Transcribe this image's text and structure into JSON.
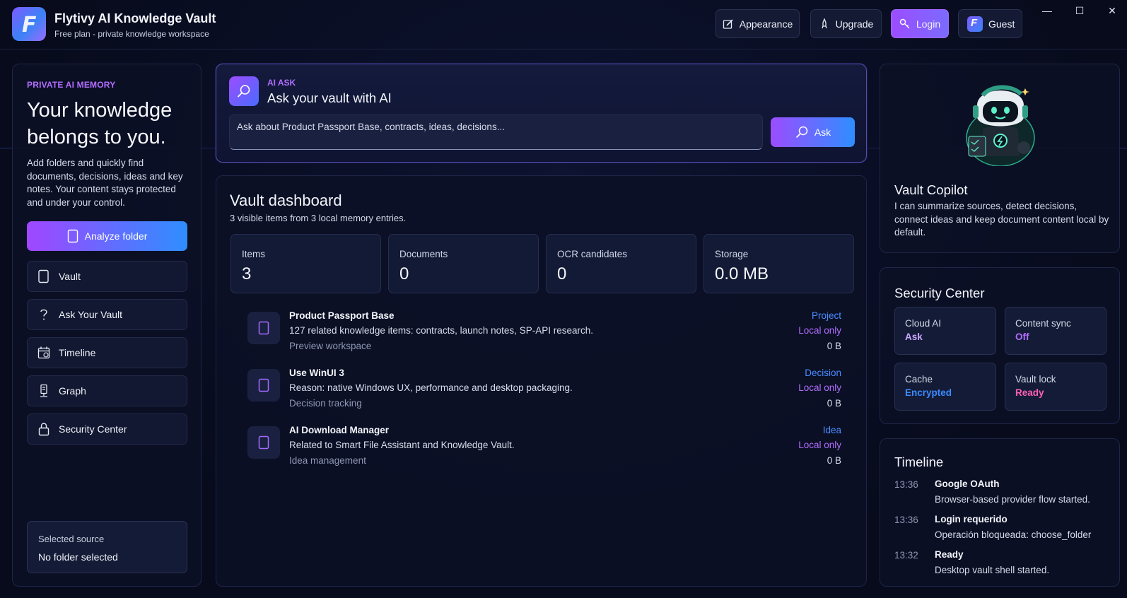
{
  "app": {
    "title": "Flytivy AI Knowledge Vault",
    "subtitle": "Free plan - private knowledge workspace",
    "logo_letter": "F"
  },
  "toolbar": {
    "appearance": "Appearance",
    "upgrade": "Upgrade",
    "login": "Login",
    "guest": "Guest"
  },
  "window_controls": {
    "minimize": "—",
    "maximize": "☐",
    "close": "✕"
  },
  "sidebar": {
    "kicker": "PRIVATE AI MEMORY",
    "hero": "Your knowledge belongs to you.",
    "description": "Add folders and quickly find documents, decisions, ideas and key notes. Your content stays protected and under your control.",
    "analyze_label": "Analyze folder",
    "nav": [
      {
        "label": "Vault",
        "icon": "document-icon"
      },
      {
        "label": "Ask Your Vault",
        "icon": "question-icon"
      },
      {
        "label": "Timeline",
        "icon": "calendar-icon"
      },
      {
        "label": "Graph",
        "icon": "graph-icon"
      },
      {
        "label": "Security Center",
        "icon": "lock-icon"
      }
    ],
    "source": {
      "label": "Selected source",
      "value": "No folder selected"
    }
  },
  "ask": {
    "kicker": "AI ASK",
    "title": "Ask your vault with AI",
    "placeholder": "Ask about Product Passport Base, contracts, ideas, decisions...",
    "button": "Ask"
  },
  "dashboard": {
    "title": "Vault dashboard",
    "subtitle": "3 visible items from 3 local memory entries.",
    "stats": [
      {
        "label": "Items",
        "value": "3"
      },
      {
        "label": "Documents",
        "value": "0"
      },
      {
        "label": "OCR candidates",
        "value": "0"
      },
      {
        "label": "Storage",
        "value": "0.0 MB"
      }
    ],
    "items": [
      {
        "title": "Product Passport Base",
        "description": "127 related knowledge items: contracts, launch notes, SP-API research.",
        "meta": "Preview workspace",
        "type": "Project",
        "privacy": "Local only",
        "size": "0 B"
      },
      {
        "title": "Use WinUI 3",
        "description": "Reason: native Windows UX, performance and desktop packaging.",
        "meta": "Decision tracking",
        "type": "Decision",
        "privacy": "Local only",
        "size": "0 B"
      },
      {
        "title": "AI Download Manager",
        "description": "Related to Smart File Assistant and Knowledge Vault.",
        "meta": "Idea management",
        "type": "Idea",
        "privacy": "Local only",
        "size": "0 B"
      }
    ]
  },
  "copilot": {
    "title": "Vault Copilot",
    "description": "I can summarize sources, detect decisions, connect ideas and keep document content local by default."
  },
  "security": {
    "title": "Security Center",
    "cards": [
      {
        "label": "Cloud AI",
        "value": "Ask",
        "color": "#c9a7ff"
      },
      {
        "label": "Content sync",
        "value": "Off",
        "color": "#b26dff"
      },
      {
        "label": "Cache",
        "value": "Encrypted",
        "color": "#3b8bff"
      },
      {
        "label": "Vault lock",
        "value": "Ready",
        "color": "#ff5fb3"
      }
    ]
  },
  "timeline": {
    "title": "Timeline",
    "events": [
      {
        "time": "13:36",
        "event": "Google OAuth",
        "detail": "Browser-based provider flow started."
      },
      {
        "time": "13:36",
        "event": "Login requerido",
        "detail": "Operación bloqueada: choose_folder"
      },
      {
        "time": "13:32",
        "event": "Ready",
        "detail": "Desktop vault shell started."
      }
    ]
  }
}
